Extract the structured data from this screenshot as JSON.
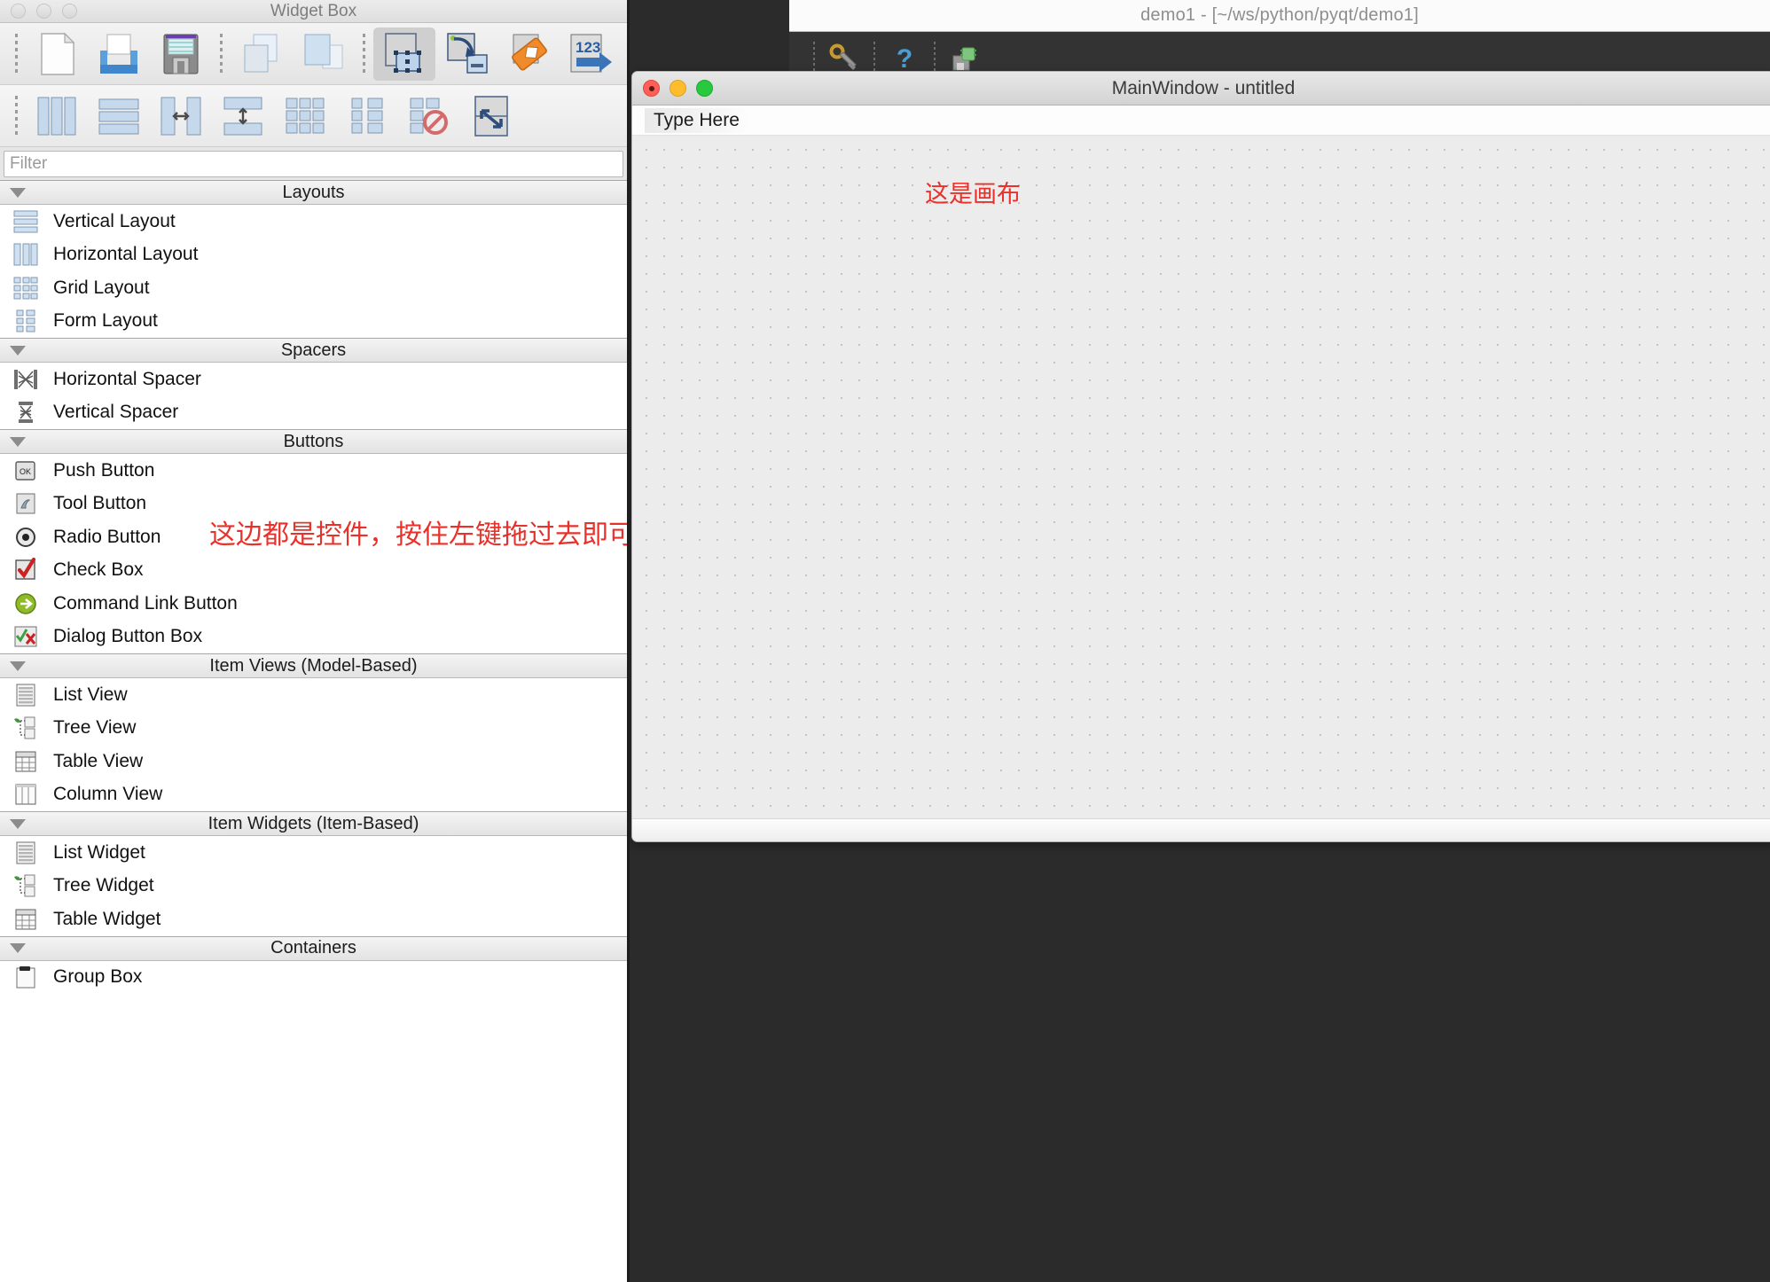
{
  "widget_box": {
    "title": "Widget Box",
    "filter_placeholder": "Filter",
    "filter_value": "",
    "toolbar_row1": [
      {
        "name": "new-form-icon",
        "label": "New"
      },
      {
        "name": "open-form-icon",
        "label": "Open"
      },
      {
        "name": "save-form-icon",
        "label": "Save"
      },
      {
        "name": "copy-icon",
        "label": "Copy"
      },
      {
        "name": "paste-icon",
        "label": "Paste"
      },
      {
        "name": "edit-widgets-icon",
        "label": "Edit Widgets",
        "active": true
      },
      {
        "name": "edit-signals-slots-icon",
        "label": "Edit Signals/Slots"
      },
      {
        "name": "edit-buddies-icon",
        "label": "Edit Buddies"
      },
      {
        "name": "edit-tab-order-icon",
        "label": "Edit Tab Order"
      }
    ],
    "toolbar_row2": [
      {
        "name": "layout-horizontally-icon",
        "label": "Lay Out Horizontally"
      },
      {
        "name": "layout-vertically-icon",
        "label": "Lay Out Vertically"
      },
      {
        "name": "layout-horizontal-splitter-icon",
        "label": "Lay Out Horizontally in Splitter"
      },
      {
        "name": "layout-vertical-splitter-icon",
        "label": "Lay Out Vertically in Splitter"
      },
      {
        "name": "layout-grid-icon",
        "label": "Lay Out in a Grid"
      },
      {
        "name": "layout-form-icon",
        "label": "Lay Out in a Form Layout"
      },
      {
        "name": "break-layout-icon",
        "label": "Break Layout"
      },
      {
        "name": "adjust-size-icon",
        "label": "Adjust Size"
      }
    ],
    "sections": [
      {
        "title": "Layouts",
        "items": [
          {
            "label": "Vertical Layout",
            "icon": "vertical-layout-icon"
          },
          {
            "label": "Horizontal Layout",
            "icon": "horizontal-layout-icon"
          },
          {
            "label": "Grid Layout",
            "icon": "grid-layout-icon"
          },
          {
            "label": "Form Layout",
            "icon": "form-layout-icon"
          }
        ]
      },
      {
        "title": "Spacers",
        "items": [
          {
            "label": "Horizontal Spacer",
            "icon": "horizontal-spacer-icon"
          },
          {
            "label": "Vertical Spacer",
            "icon": "vertical-spacer-icon"
          }
        ]
      },
      {
        "title": "Buttons",
        "items": [
          {
            "label": "Push Button",
            "icon": "push-button-icon"
          },
          {
            "label": "Tool Button",
            "icon": "tool-button-icon"
          },
          {
            "label": "Radio Button",
            "icon": "radio-button-icon"
          },
          {
            "label": "Check Box",
            "icon": "check-box-icon"
          },
          {
            "label": "Command Link Button",
            "icon": "command-link-button-icon"
          },
          {
            "label": "Dialog Button Box",
            "icon": "dialog-button-box-icon"
          }
        ]
      },
      {
        "title": "Item Views (Model-Based)",
        "items": [
          {
            "label": "List View",
            "icon": "list-view-icon"
          },
          {
            "label": "Tree View",
            "icon": "tree-view-icon"
          },
          {
            "label": "Table View",
            "icon": "table-view-icon"
          },
          {
            "label": "Column View",
            "icon": "column-view-icon"
          }
        ]
      },
      {
        "title": "Item Widgets (Item-Based)",
        "items": [
          {
            "label": "List Widget",
            "icon": "list-widget-icon"
          },
          {
            "label": "Tree Widget",
            "icon": "tree-widget-icon"
          },
          {
            "label": "Table Widget",
            "icon": "table-widget-icon"
          }
        ]
      },
      {
        "title": "Containers",
        "items": [
          {
            "label": "Group Box",
            "icon": "group-box-icon"
          }
        ]
      }
    ],
    "annotation": "这边都是控件，按住左键拖过去即可"
  },
  "designer": {
    "window_title": "demo1 - [~/ws/python/pyqt/demo1]",
    "toolbar": [
      {
        "name": "settings-wrench-icon",
        "label": "Preferences"
      },
      {
        "name": "help-question-icon",
        "label": "Help"
      },
      {
        "name": "save-chip-icon",
        "label": "Save Form"
      }
    ],
    "form": {
      "title": "MainWindow - untitled",
      "menu_placeholder": "Type Here",
      "annotation": "这是画布"
    }
  },
  "colors": {
    "annotation_red": "#e8312a",
    "toolbar_dark": "#333333",
    "canvas_bg": "#ececec",
    "panel_bg": "#ffffff"
  }
}
